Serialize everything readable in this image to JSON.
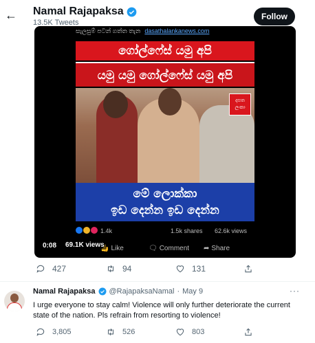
{
  "header": {
    "name": "Namal Rajapaksa",
    "tweets_count": "13.5K Tweets",
    "follow_label": "Follow"
  },
  "video": {
    "top_caption": "සැලසුම් පටන් ගත්ත තැන",
    "site": "dasathalankanews.com",
    "banner1": "ගෝල්ෆේස් යමු අපි",
    "banner2": "යමු යමු ගෝල්ෆේස් යමු අපි",
    "banner3_line1": "මේ ලොක්කා",
    "banner3_line2": "ඉඩ දෙන්න ඉඩ දෙන්න",
    "logo_text": "දසත ලංකා",
    "reaction_count": "1.4k",
    "shares": "1.5k shares",
    "fb_views": "62.6k views",
    "like_label": "Like",
    "comment_label": "Comment",
    "share_label": "Share",
    "timer": "0:08",
    "views_badge": "69.1K views"
  },
  "tweet1_actions": {
    "replies": "427",
    "retweets": "94",
    "likes": "131"
  },
  "reply": {
    "name": "Namal Rajapaksa",
    "handle": "@RajapaksaNamal",
    "date": "May 9",
    "text": "I urge everyone to stay calm! Violence will only further deteriorate the current state of the nation. Pls refrain from resorting to violence!",
    "replies": "3,805",
    "retweets": "526",
    "likes": "803"
  },
  "colors": {
    "verified": "#1d9bf0",
    "follow_bg": "#0f1419",
    "muted": "#536471",
    "red_banner": "#d9161d",
    "blue_banner": "#1c3fa8"
  }
}
